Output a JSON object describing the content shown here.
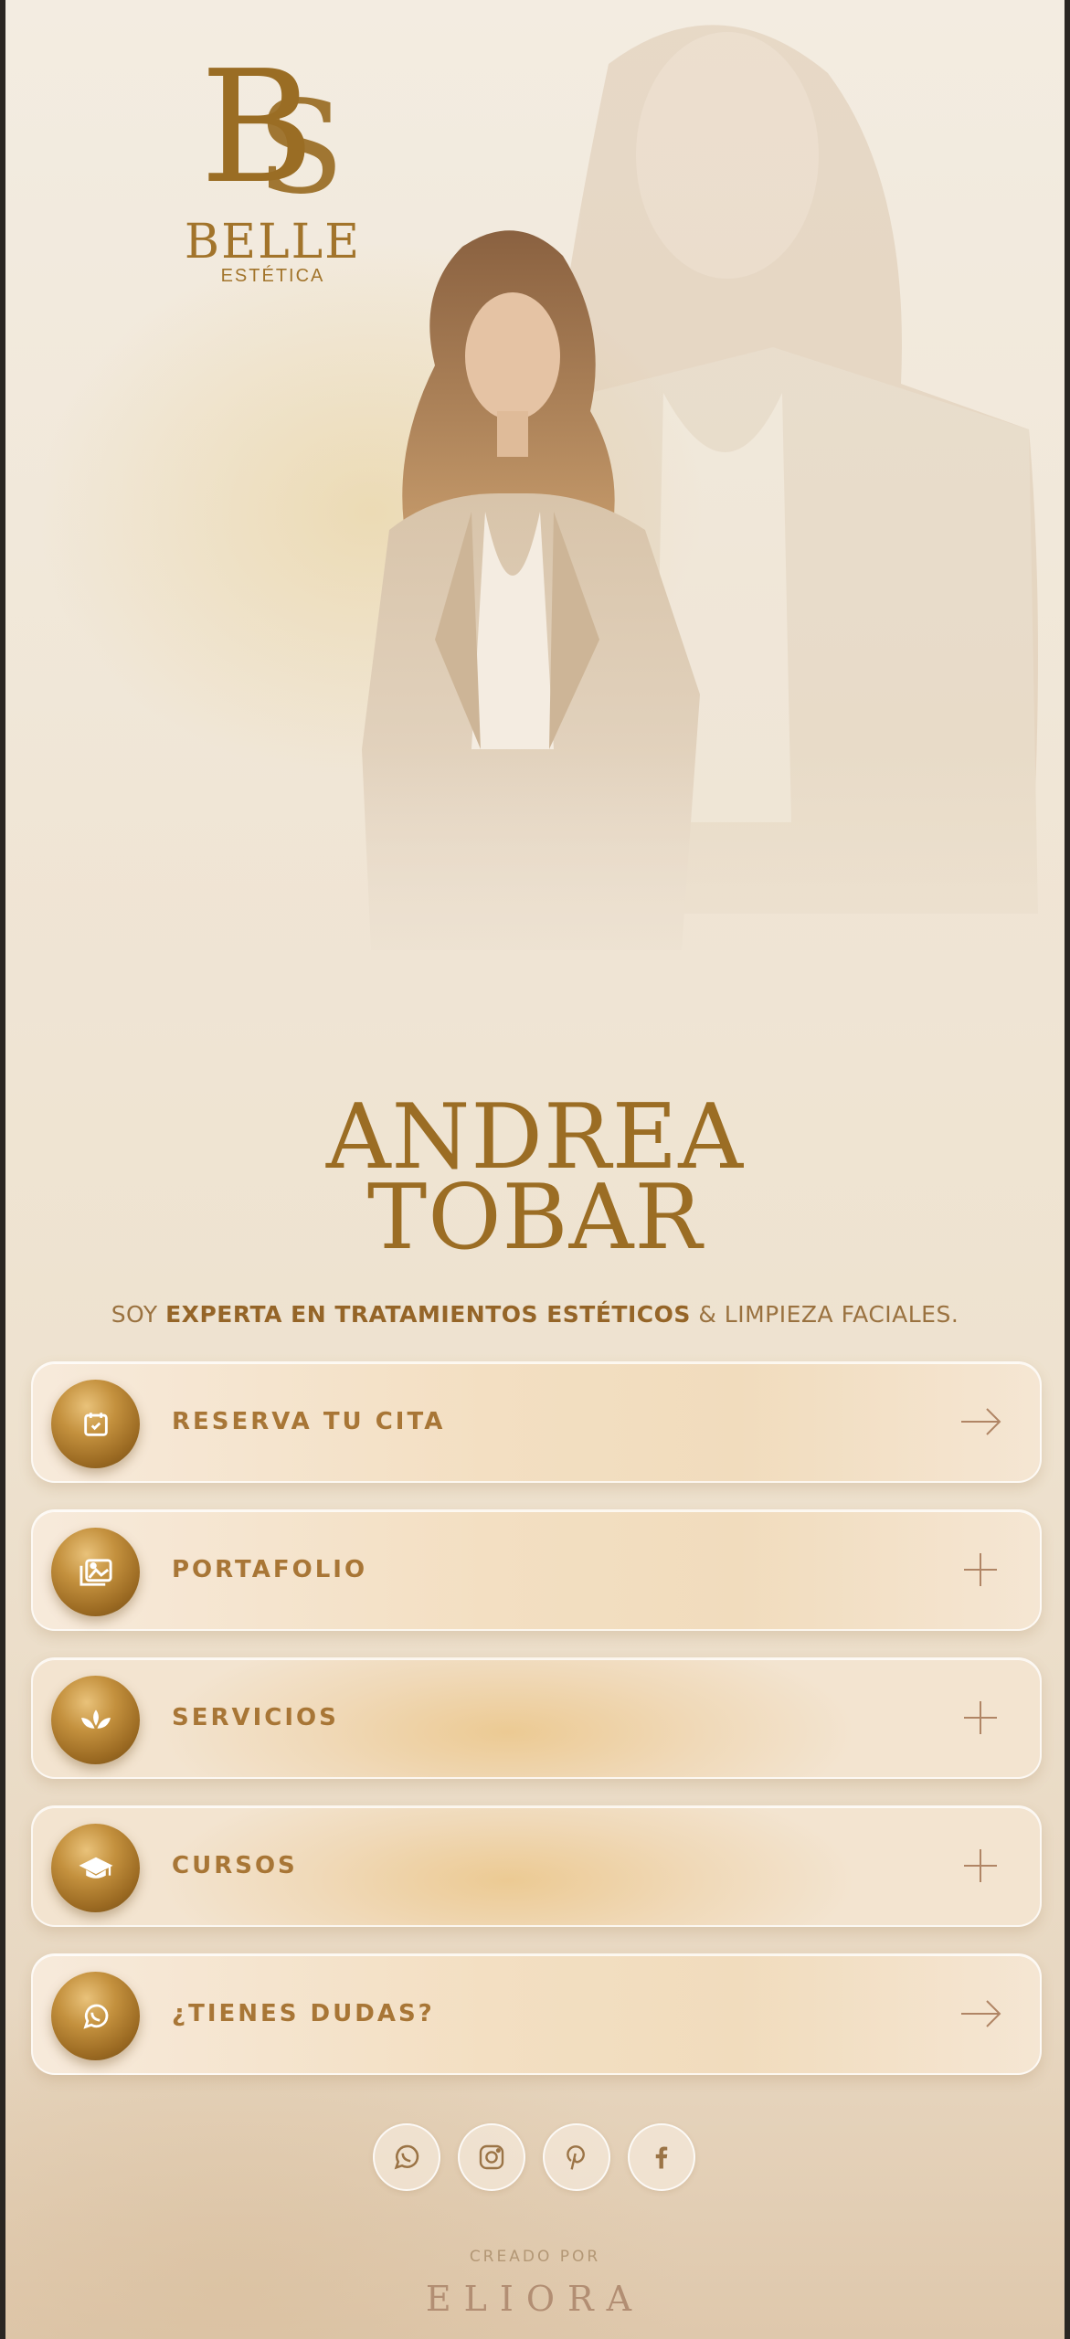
{
  "logo": {
    "monogram": "BS",
    "name": "BELLE",
    "subtitle": "ESTÉTICA"
  },
  "profile": {
    "first_name": "ANDREA",
    "last_name": "TOBAR",
    "tagline_prefix": "SOY ",
    "tagline_bold": "EXPERTA EN TRATAMIENTOS ESTÉTICOS",
    "tagline_suffix": " & LIMPIEZA FACIALES."
  },
  "menu": [
    {
      "label": "RESERVA TU CITA",
      "icon": "calendar-check-icon",
      "action": "arrow"
    },
    {
      "label": "PORTAFOLIO",
      "icon": "gallery-icon",
      "action": "plus"
    },
    {
      "label": "SERVICIOS",
      "icon": "lotus-icon",
      "action": "plus"
    },
    {
      "label": "CURSOS",
      "icon": "graduation-cap-icon",
      "action": "plus"
    },
    {
      "label": "¿TIENES DUDAS?",
      "icon": "whatsapp-icon",
      "action": "arrow"
    }
  ],
  "social": [
    "whatsapp-icon",
    "instagram-icon",
    "pinterest-icon",
    "facebook-icon"
  ],
  "footer": {
    "credit": "CREADO POR",
    "brand": "ELIORA"
  },
  "colors": {
    "gold": "#a87636",
    "dark_gold": "#9b6d24",
    "background": "#f0e6d6"
  }
}
